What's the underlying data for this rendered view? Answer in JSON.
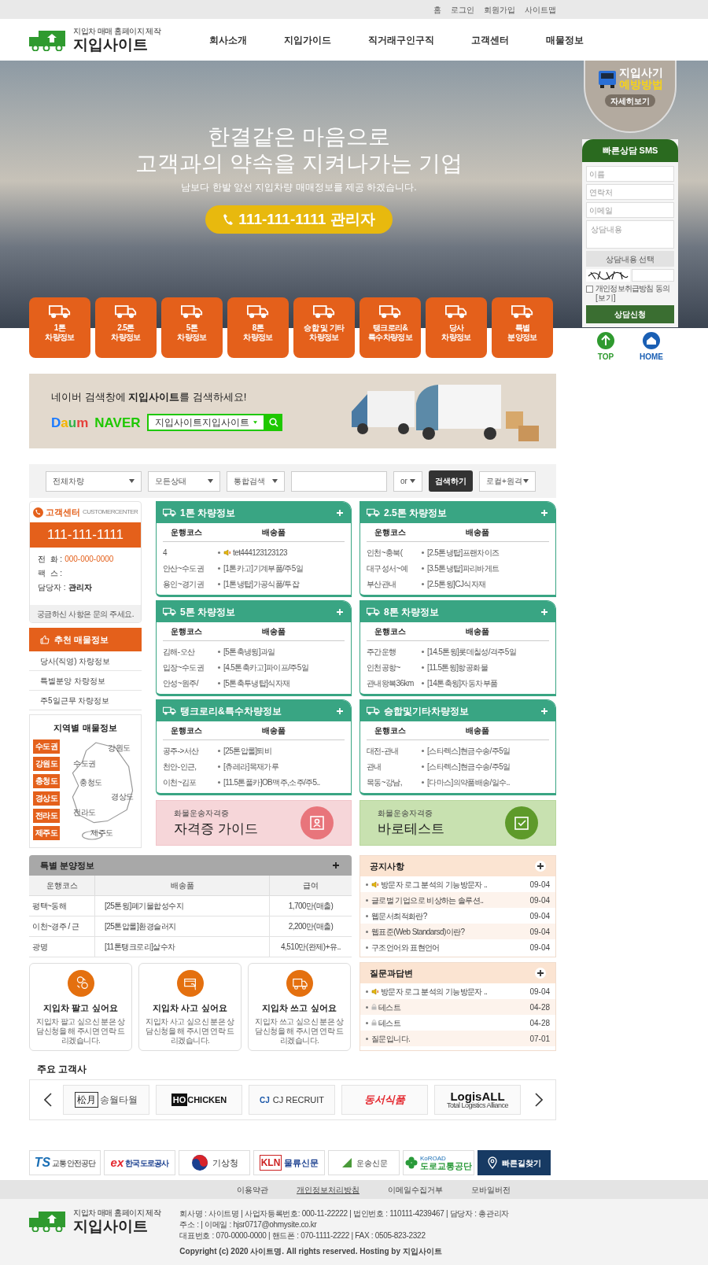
{
  "top_links": [
    "홈",
    "로그인",
    "회원가입",
    "사이트맵"
  ],
  "logo": {
    "tagline": "지입차 매매 홈페이지 제작",
    "name": "지입사이트"
  },
  "nav": [
    "회사소개",
    "지입가이드",
    "직거래구인구직",
    "고객센터",
    "매물정보"
  ],
  "hero": {
    "headline_1": "**한결**같은 마음으로",
    "headline_2": "고객과의 **약속**을 지켜나가는 기업",
    "subtitle": "남보다 한발 앞선 지입차량 매매정보를 제공 하겠습니다.",
    "phone_button": "111-111-1111 관리자"
  },
  "categories": [
    {
      "label": "1톤\n차량정보"
    },
    {
      "label": "2.5톤\n차량정보"
    },
    {
      "label": "5톤\n차량정보"
    },
    {
      "label": "8톤\n차량정보"
    },
    {
      "label": "승합 및 기타\n차량정보"
    },
    {
      "label": "탱크로리&\n특수차량정보"
    },
    {
      "label": "당사\n차량정보"
    },
    {
      "label": "특별\n분양정보"
    }
  ],
  "side_banner": {
    "title": "지입사기",
    "highlight": "예방방법",
    "button": "자세히보기"
  },
  "sms_form": {
    "title": "빠른상담 SMS",
    "fields": [
      {
        "placeholder": "이름"
      },
      {
        "placeholder": "연락처"
      },
      {
        "placeholder": "이메일"
      }
    ],
    "message_placeholder": "상담내용",
    "select": "상담내용 선택",
    "agree_label": "개인정보취급방침 동의",
    "view_link": "[보기]",
    "agree_checked": false,
    "submit": "상담신청"
  },
  "quick_links": [
    {
      "kind": "top",
      "label": "TOP"
    },
    {
      "kind": "home",
      "label": "HOME"
    }
  ],
  "search_banner": {
    "prompt": "네이버 검색창에 **지입사이트**를 검색하세요!",
    "daum": "Daum",
    "naver": "NAVER",
    "query": "지입사이트지입사이트"
  },
  "search_bar": {
    "selects": [
      "전체차량",
      "모든상태",
      "통합검색"
    ],
    "operator": "or",
    "button": "검색하기",
    "scope": "로컬+원격"
  },
  "customer_center": {
    "title": "고객센터",
    "subtitle": "CUSTOMERCENTER",
    "phone": "111-111-1111",
    "rows": [
      {
        "label": "전  화 :",
        "value": "000-000-0000"
      },
      {
        "label": "팩  스 :"
      },
      {
        "label": "담당자 :",
        "value": "관리자"
      }
    ],
    "note": "궁금하신 사항은 문의 주세요."
  },
  "recommend": {
    "title": "추천 매물정보",
    "items": [
      "당사(직영) 차량정보",
      "특별분양 차량정보",
      "주5일근무 차량정보"
    ]
  },
  "regions": {
    "title": "지역별 매물정보",
    "buttons": [
      "수도권",
      "강원도",
      "충청도",
      "경상도",
      "전라도",
      "제주도"
    ],
    "map_labels": [
      "강원도",
      "수도권",
      "충청도",
      "경상도",
      "전라도",
      "제주도"
    ]
  },
  "vehicle_boards": [
    {
      "title": "1톤 차량정보",
      "columns": [
        "운행코스",
        "배송품"
      ],
      "rows": [
        {
          "course": "4",
          "item": "tet444123123123",
          "notice": true
        },
        {
          "course": "안산~수도권",
          "item": "[1톤카고]기계부품/주5일",
          "notice": false
        },
        {
          "course": "용인~경기권",
          "item": "[1톤냉탑]가공식품/투잡",
          "notice": false
        }
      ]
    },
    {
      "title": "2.5톤 차량정보",
      "columns": [
        "운행코스",
        "배송품"
      ],
      "rows": [
        {
          "course": "인천~충북(",
          "item": "[2.5톤냉탑]프랜차이즈",
          "notice": false
        },
        {
          "course": "대구성서~예",
          "item": "[3.5톤냉탑]파리바게트",
          "notice": false
        },
        {
          "course": "부산관내",
          "item": "[2.5톤윙]CJ식자재",
          "notice": false
        }
      ]
    },
    {
      "title": "5톤 차량정보",
      "columns": [
        "운행코스",
        "배송품"
      ],
      "rows": [
        {
          "course": "김해-오산",
          "item": "[5톤축냉윙]과일",
          "notice": false
        },
        {
          "course": "입장~수도권",
          "item": "[4.5톤축카고]파이프/주5일",
          "notice": false
        },
        {
          "course": "안성~원주/",
          "item": "[5톤축투냉탑]식자재",
          "notice": false
        }
      ]
    },
    {
      "title": "8톤 차량정보",
      "columns": [
        "운행코스",
        "배송품"
      ],
      "rows": [
        {
          "course": "주간운행",
          "item": "[14.5톤윙]롯데칠성/격주5일",
          "notice": false
        },
        {
          "course": "인천공항~",
          "item": "[11.5톤윙]항공화물",
          "notice": false
        },
        {
          "course": "관내왕복36km",
          "item": "[14톤축윙]자동차부품",
          "notice": false
        }
      ]
    },
    {
      "title": "탱크로리&특수차량정보",
      "columns": [
        "운행코스",
        "배송품"
      ],
      "rows": [
        {
          "course": "공주->서산",
          "item": "[25톤압롤]퇴비",
          "notice": false
        },
        {
          "course": "천안-인근,",
          "item": "[츄레라]목재가루",
          "notice": false
        },
        {
          "course": "이천~김포",
          "item": "[11.5톤풀카]OB맥주,소주/주5..",
          "notice": false
        }
      ]
    },
    {
      "title": "승합및기타차량정보",
      "columns": [
        "운행코스",
        "배송품"
      ],
      "rows": [
        {
          "course": "대전-관내",
          "item": "[스타렉스]현금수송/주5일",
          "notice": false
        },
        {
          "course": "관내",
          "item": "[스타렉스]현금수송/주5일",
          "notice": false
        },
        {
          "course": "목동~강남,",
          "item": "[다마스]의약품배송/일수..",
          "notice": false
        }
      ]
    }
  ],
  "cert_banners": [
    {
      "kind": "guide",
      "caption": "화물운송자격증",
      "title": "자격증 가이드"
    },
    {
      "kind": "test",
      "caption": "화물운송자격증",
      "title": "바로테스트"
    }
  ],
  "special": {
    "title": "특별 분양정보",
    "columns": [
      "운행코스",
      "배송품",
      "급여"
    ],
    "rows": [
      [
        "평택~동해",
        "[25톤윙]폐기물합성수지",
        "1,700만(매출)"
      ],
      [
        "이천~경주 / 근",
        "[25톤압롤]환경슬러지",
        "2,200만(매출)"
      ],
      [
        "광명",
        "[11톤탱크로리]살수차",
        "4,510만(완제)+유.."
      ]
    ]
  },
  "notices": {
    "title": "공지사항",
    "items": [
      {
        "kind": "notice",
        "text": "방문자 로그 분석의 기능방문자 ..",
        "date": "09-04"
      },
      {
        "kind": "normal",
        "text": "글로벌 기업으로 비상하는 솔루션..",
        "date": "09-04"
      },
      {
        "kind": "normal",
        "text": "웹문서최적화란?",
        "date": "09-04"
      },
      {
        "kind": "normal",
        "text": "웹표준(Web Standarsd)이란?",
        "date": "09-04"
      },
      {
        "kind": "normal",
        "text": "구조언어와 표현언어",
        "date": "09-04"
      }
    ]
  },
  "qna": {
    "title": "질문과답변",
    "items": [
      {
        "kind": "notice",
        "text": "방문자 로그 분석의 기능방문자 ..",
        "date": "09-04"
      },
      {
        "kind": "secret",
        "text": "테스트",
        "date": "04-28"
      },
      {
        "kind": "secret",
        "text": "테스트",
        "date": "04-28"
      },
      {
        "kind": "normal",
        "text": "질문입니다.",
        "date": "07-01"
      }
    ]
  },
  "services": [
    {
      "kind": "sell",
      "title": "지입차 팔고 싶어요",
      "desc": "지입차 팔고 싶으신 분은 상담신청을 해 주시면 연락 드리겠습니다."
    },
    {
      "kind": "buy",
      "title": "지입차 사고 싶어요",
      "desc": "지입차 사고 싶으신 분은 상담신청을 해 주시면 연락 드리겠습니다."
    },
    {
      "kind": "use",
      "title": "지입차 쓰고 싶어요",
      "desc": "지입차 쓰고 싶으신 분은 상담신청을 해 주시면 연락 드리겠습니다."
    }
  ],
  "clients": {
    "title": "주요 고객사",
    "logos": [
      {
        "kind": "songwol",
        "mark": "松月",
        "text": "송월타월"
      },
      {
        "kind": "hochicken",
        "mark": "HO",
        "text": "CHICKEN"
      },
      {
        "kind": "cj",
        "mark": "CJ",
        "text": "CJ RECRUIT"
      },
      {
        "kind": "dongsuh",
        "text": "동서식품"
      },
      {
        "kind": "logisall",
        "text": "LogisALL",
        "sub": "Total Logistics Alliance"
      }
    ]
  },
  "partners": [
    {
      "kind": "ts",
      "mark": "TS",
      "text": "교통안전공단"
    },
    {
      "kind": "ex",
      "mark": "ex",
      "text": "한국도로공사"
    },
    {
      "kind": "kma",
      "text": "기상청"
    },
    {
      "kind": "kln",
      "mark": "KLN",
      "text": "물류신문"
    },
    {
      "kind": "transport",
      "text": "운송신문"
    },
    {
      "kind": "koroad",
      "mark": "KoROAD",
      "text": "도로교통공단"
    },
    {
      "kind": "route",
      "text": "빠른길찾기"
    }
  ],
  "footer_links": [
    {
      "label": "이용약관",
      "emphasis": false
    },
    {
      "label": "개인정보처리방침",
      "emphasis": true
    },
    {
      "label": "이메일수집거부",
      "emphasis": false
    },
    {
      "label": "모바일버전",
      "emphasis": false
    }
  ],
  "footer": {
    "logo": {
      "tagline": "지입차 매매 홈페이지 제작",
      "name": "지입사이트"
    },
    "lines": [
      "회사명 : 사이트명 | 사업자등록번호: 000-11-22222 | 법인번호 : 110111-4239467 | 담당자 : 총관리자",
      "주소 : | 이메일 : hjsr0717@ohmysite.co.kr",
      "대표번호 : 070-0000-0000 | 핸드폰 : 070-1111-2222 | FAX : 0505-823-2322"
    ],
    "copyright": "Copyright (c) 2020 사이트명. All rights reserved. Hosting by 지입사이트"
  }
}
